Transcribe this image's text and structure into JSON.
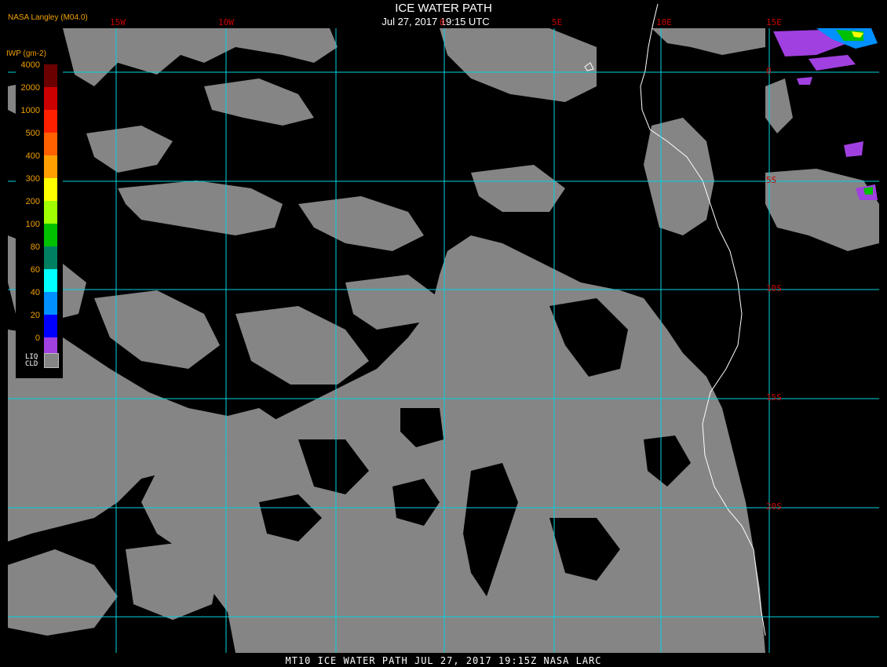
{
  "header": {
    "title": "ICE WATER PATH",
    "subtitle": "Jul 27, 2017 19:15 UTC",
    "producer": "NASA Langley (M04.0)"
  },
  "footer": {
    "caption": "MT10  ICE WATER PATH  JUL 27, 2017 19:15Z  NASA LARC"
  },
  "map": {
    "longitude_labels": [
      "15W",
      "10W",
      "0",
      "5E",
      "10E",
      "15E"
    ],
    "latitude_labels": [
      "0",
      "5S",
      "10S",
      "15S",
      "20S"
    ],
    "land_color": "#000000",
    "cloud_color": "#858585",
    "grid_color": "#00d4e0",
    "coast_color": "#ffffff"
  },
  "legend": {
    "title": "IWP (gm-2)",
    "ticks": [
      "4000",
      "2000",
      "1000",
      "500",
      "400",
      "300",
      "200",
      "100",
      "80",
      "60",
      "40",
      "20",
      "0"
    ],
    "colors": [
      "#6a0000",
      "#cc0000",
      "#ff2000",
      "#ff6000",
      "#ffa000",
      "#ffff00",
      "#a0ff00",
      "#00c000",
      "#008060",
      "#00ffff",
      "#0090ff",
      "#0000ff",
      "#a040e0"
    ],
    "liquid_label_top": "LIQ",
    "liquid_label_bottom": "CLD",
    "liquid_color": "#858585"
  }
}
